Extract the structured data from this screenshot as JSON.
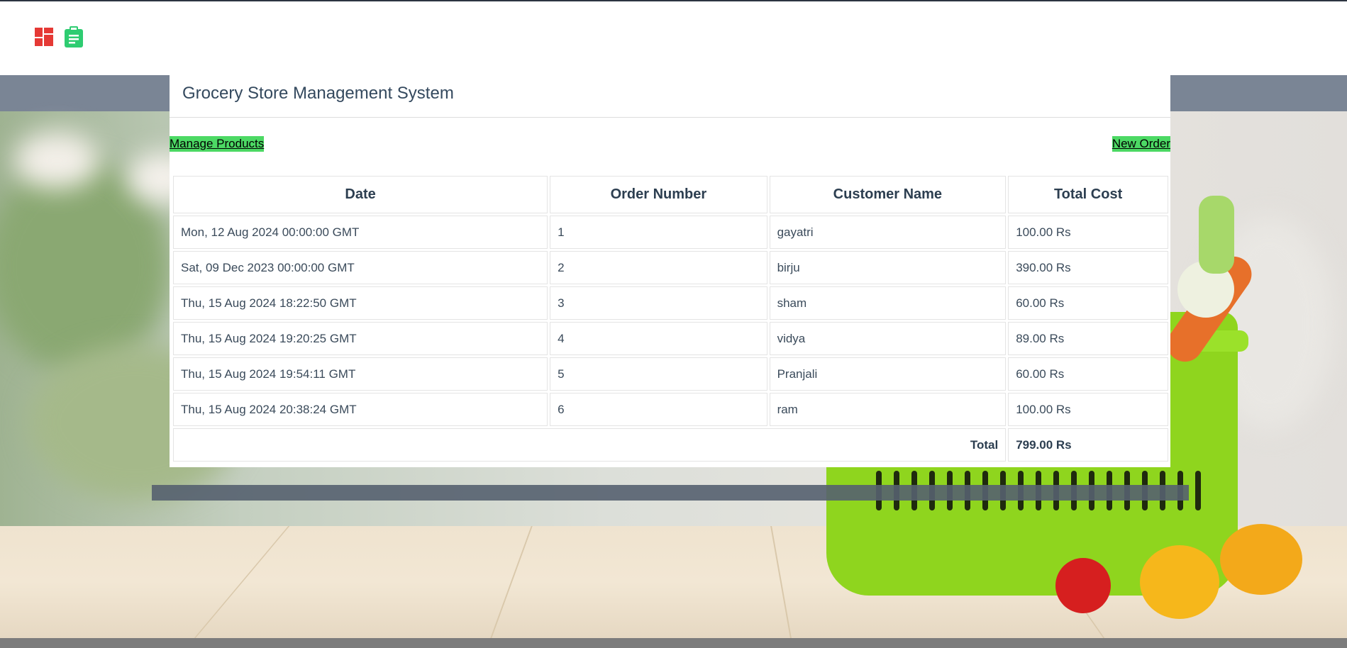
{
  "header": {
    "dashboard_icon": "dashboard-icon",
    "orders_icon": "clipboard-icon"
  },
  "panel": {
    "title": "Grocery Store Management System",
    "manage_products": "Manage Products",
    "new_order": "New Order"
  },
  "table": {
    "headers": [
      "Date",
      "Order Number",
      "Customer Name",
      "Total Cost"
    ],
    "rows": [
      [
        "Mon, 12 Aug 2024 00:00:00 GMT",
        "1",
        "gayatri",
        "100.00 Rs"
      ],
      [
        "Sat, 09 Dec 2023 00:00:00 GMT",
        "2",
        "birju",
        "390.00 Rs"
      ],
      [
        "Thu, 15 Aug 2024 18:22:50 GMT",
        "3",
        "sham",
        "60.00 Rs"
      ],
      [
        "Thu, 15 Aug 2024 19:20:25 GMT",
        "4",
        "vidya",
        "89.00 Rs"
      ],
      [
        "Thu, 15 Aug 2024 19:54:11 GMT",
        "5",
        "Pranjali",
        "60.00 Rs"
      ],
      [
        "Thu, 15 Aug 2024 20:38:24 GMT",
        "6",
        "ram",
        "100.00 Rs"
      ]
    ],
    "total_label": "Total",
    "total_value": "799.00 Rs"
  },
  "colors": {
    "button_green": "#4cd964",
    "title": "#34495e",
    "logo_red": "#e53935",
    "logo_green": "#2ecc71"
  }
}
